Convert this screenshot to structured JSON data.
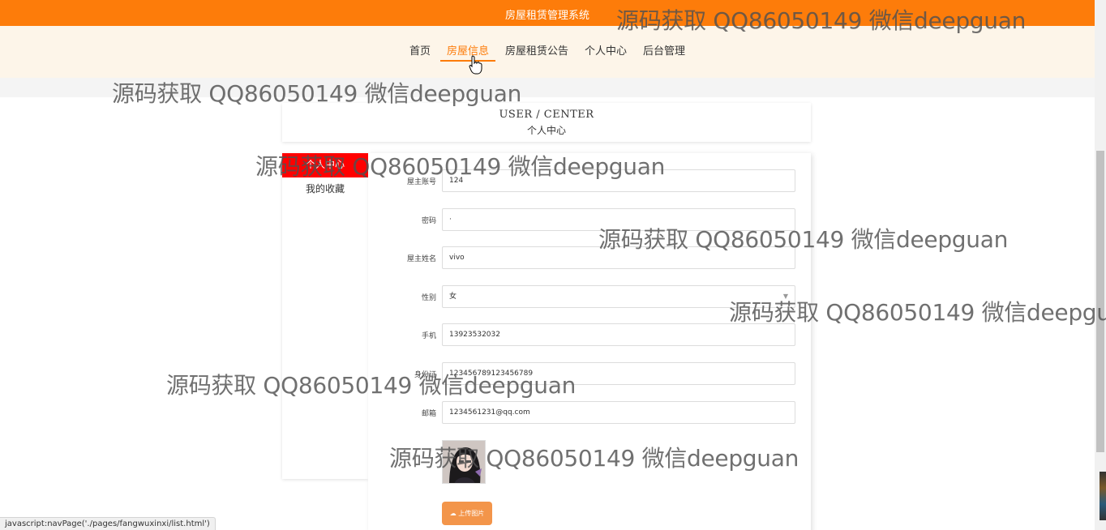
{
  "app": {
    "title": "房屋租赁管理系统"
  },
  "nav": {
    "items": [
      "首页",
      "房屋信息",
      "房屋租赁公告",
      "个人中心",
      "后台管理"
    ],
    "active_index": 1
  },
  "header": {
    "en": "USER / CENTER",
    "cn": "个人中心"
  },
  "sidebar": {
    "items": [
      {
        "label": "个人中心",
        "active": true
      },
      {
        "label": "我的收藏",
        "active": false
      }
    ]
  },
  "form": {
    "fields": [
      {
        "label": "屋主账号",
        "value": "124"
      },
      {
        "label": "密码",
        "value": "·"
      },
      {
        "label": "屋主姓名",
        "value": "vivo"
      },
      {
        "label": "性别",
        "value": "女"
      },
      {
        "label": "手机",
        "value": "13923532032"
      },
      {
        "label": "身份证",
        "value": "123456789123456789"
      },
      {
        "label": "邮箱",
        "value": "1234561231@qq.com"
      }
    ],
    "upload_label": "上传图片"
  },
  "status_bar": {
    "text": "javascript:navPage('./pages/fangwuxinxi/list.html')"
  },
  "watermark": {
    "text": "源码获取 QQ86050149 微信deepguan"
  },
  "colors": {
    "accent": "#fd7c0a",
    "active_menu": "#ff0000",
    "upload": "#f3954a"
  },
  "icons": {
    "cursor": "hand-pointer-icon",
    "upload": "cloud-upload-icon",
    "select_caret": "chevron-down-icon"
  }
}
